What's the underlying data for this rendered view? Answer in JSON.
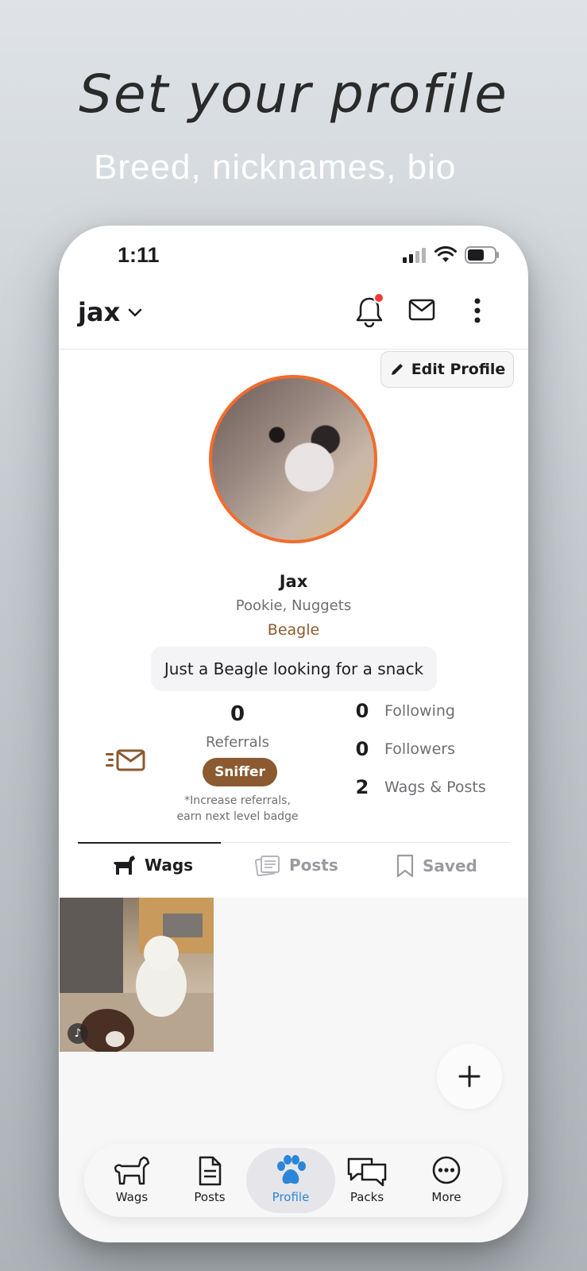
{
  "promo": {
    "headline": "Set your profile",
    "subheadline": "Breed, nicknames, bio"
  },
  "status_bar": {
    "time": "1:11"
  },
  "header": {
    "username": "jax",
    "icons": [
      "chevron-down-icon",
      "bell-icon",
      "mail-icon",
      "more-vertical-icon"
    ],
    "has_notification": true
  },
  "profile": {
    "edit_label": "Edit Profile",
    "name": "Jax",
    "nicknames": "Pookie, Nuggets",
    "breed": "Beagle",
    "bio": "Just a Beagle looking for a snack",
    "avatar_border_color": "#f26b2e"
  },
  "referrals": {
    "count": "0",
    "label": "Referrals",
    "badge": "Sniffer",
    "note_line1": "*Increase referrals,",
    "note_line2": "earn next level badge"
  },
  "stats": [
    {
      "value": "0",
      "label": "Following"
    },
    {
      "value": "0",
      "label": "Followers"
    },
    {
      "value": "2",
      "label": "Wags & Posts"
    }
  ],
  "tabs": [
    {
      "label": "Wags",
      "icon": "dog-icon",
      "active": true
    },
    {
      "label": "Posts",
      "icon": "posts-icon",
      "active": false
    },
    {
      "label": "Saved",
      "icon": "bookmark-icon",
      "active": false
    }
  ],
  "bottom_nav": [
    {
      "label": "Wags",
      "icon": "dog-icon"
    },
    {
      "label": "Posts",
      "icon": "document-icon"
    },
    {
      "label": "Profile",
      "icon": "paw-icon",
      "active": true
    },
    {
      "label": "Packs",
      "icon": "chat-bubbles-icon"
    },
    {
      "label": "More",
      "icon": "more-horizontal-icon"
    }
  ],
  "colors": {
    "accent_blue": "#2b86d8",
    "badge_brown": "#8b5a31",
    "breed_brown": "#8c5a2e",
    "notification_red": "#f03a3a"
  }
}
